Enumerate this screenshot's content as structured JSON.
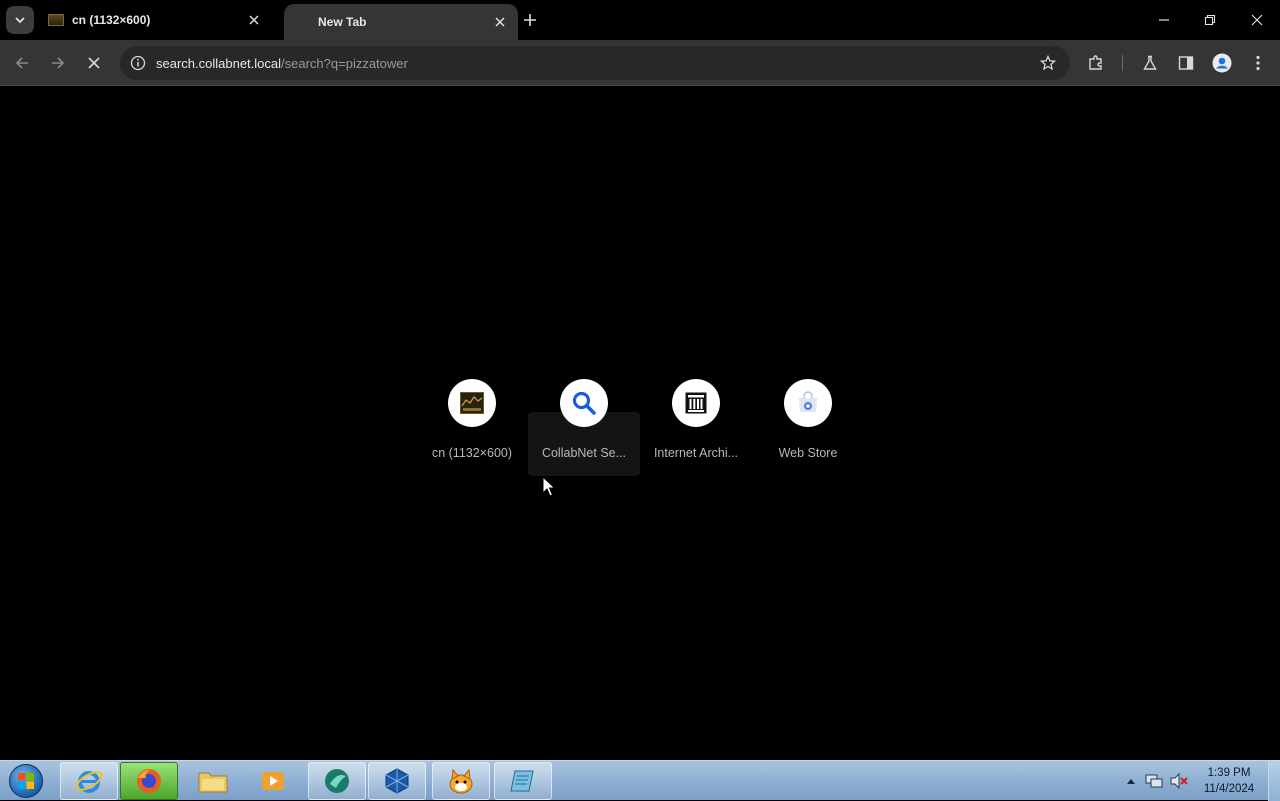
{
  "tabs": [
    {
      "title": "cn (1132×600)",
      "active": false
    },
    {
      "title": "New Tab",
      "active": true
    }
  ],
  "icons": {
    "tab_search": "chevron-down-icon",
    "tab_close": "close-icon",
    "new_tab": "plus-icon",
    "minimize": "minimize-icon",
    "restore": "restore-icon",
    "window_close": "close-icon",
    "back": "back-arrow-icon",
    "forward": "forward-arrow-icon",
    "reload_stop": "stop-icon",
    "site_info": "info-icon",
    "bookmark": "star-icon",
    "extensions": "puzzle-icon",
    "labs": "flask-icon",
    "side_panel": "side-panel-icon",
    "profile": "profile-icon",
    "menu": "kebab-menu-icon"
  },
  "address_bar": {
    "host": "search.collabnet.local",
    "path": "/search?q=pizzatower"
  },
  "shortcuts": [
    {
      "label": "cn (1132×600)",
      "icon": "image-thumbnail-icon"
    },
    {
      "label": "CollabNet Se...",
      "icon": "search-icon"
    },
    {
      "label": "Internet Archi...",
      "icon": "archive-building-icon"
    },
    {
      "label": "Web Store",
      "icon": "web-store-icon"
    }
  ],
  "taskbar": {
    "apps": [
      "internet-explorer-icon",
      "firefox-icon",
      "file-explorer-icon",
      "media-player-icon",
      "app-teal-icon",
      "virtualbox-icon",
      "scratch-cat-icon",
      "notepad-icon"
    ],
    "clock_time": "1:39 PM",
    "clock_date": "11/4/2024"
  },
  "colors": {
    "background": "#000000",
    "toolbar": "#353535",
    "omnibox": "#282828",
    "taskbar": "#8fb0d4"
  }
}
